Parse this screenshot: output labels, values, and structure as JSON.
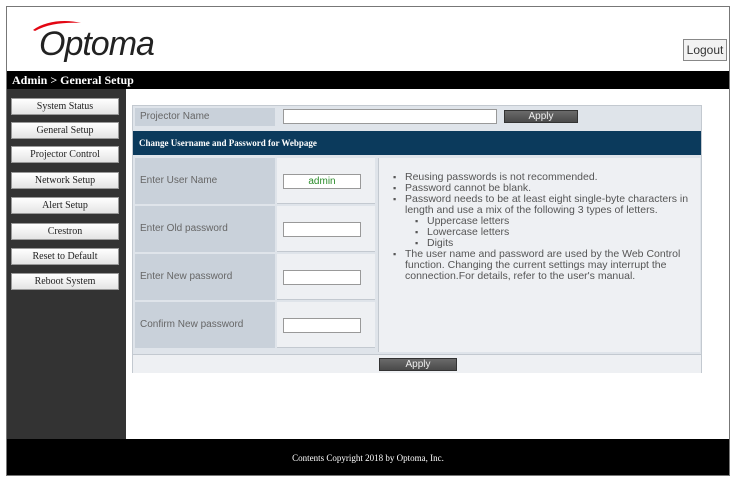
{
  "header": {
    "logo_text": "Optoma",
    "logout_label": "Logout",
    "breadcrumb": "Admin > General Setup",
    "brand_color": "#e30613"
  },
  "sidebar": {
    "items": [
      {
        "label": "System Status"
      },
      {
        "label": "General Setup"
      },
      {
        "label": "Projector Control"
      },
      {
        "label": "Network Setup"
      },
      {
        "label": "Alert Setup"
      },
      {
        "label": "Crestron"
      },
      {
        "label": "Reset to Default"
      },
      {
        "label": "Reboot System"
      }
    ]
  },
  "projector_name": {
    "label": "Projector Name",
    "value": "",
    "apply_label": "Apply"
  },
  "section": {
    "title": "Change Username and Password for Webpage"
  },
  "form": {
    "username_label": "Enter User Name",
    "username_value": "admin",
    "old_password_label": "Enter Old password",
    "new_password_label": "Enter New password",
    "confirm_password_label": "Confirm New password"
  },
  "info": {
    "items": [
      "Reusing passwords is not recommended.",
      "Password cannot be blank.",
      "Password needs to be at least eight single-byte characters in length and use a mix of the following 3 types of letters.",
      "Uppercase letters",
      "Lowercase letters",
      "Digits",
      "The user name and password are used by the Web Control function. Changing the current settings may interrupt the connection.For details, refer to the user's manual."
    ]
  },
  "apply_bottom_label": "Apply",
  "footer": {
    "copyright": "Contents Copyright 2018 by Optoma, Inc."
  }
}
